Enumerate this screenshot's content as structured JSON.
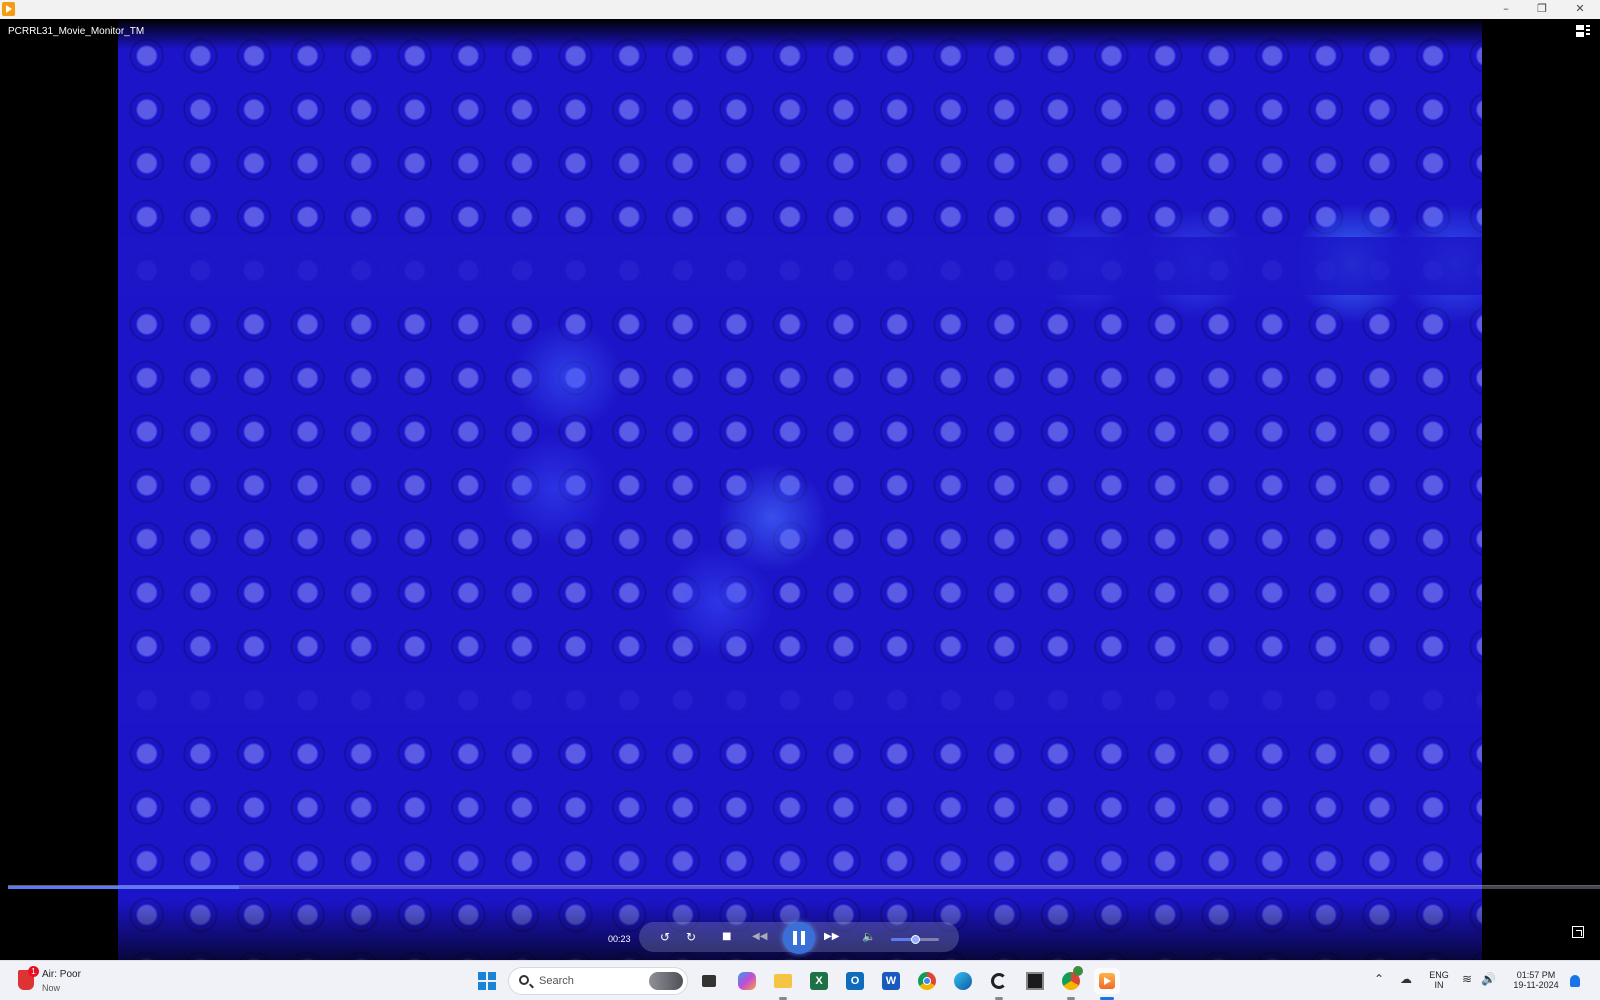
{
  "window": {
    "title": "",
    "minimize_icon": "minimize-icon",
    "maximize_icon": "restore-icon",
    "close_icon": "close-icon"
  },
  "player": {
    "media_title": "PCRRL31_Movie_Monitor_TM",
    "current_time": "00:23",
    "progress": 0.145,
    "volume": 0.5,
    "accent_color": "#3b6fd8",
    "video_dominant_color": "#1c14c8",
    "controls": {
      "rewind_icon": "skip-back-10-icon",
      "forward_icon": "skip-forward-30-icon",
      "stop_icon": "stop-icon",
      "previous_icon": "previous-track-icon",
      "play_pause_icon": "pause-icon",
      "next_icon": "next-track-icon",
      "volume_icon": "volume-icon",
      "fullscreen_icon": "fullscreen-icon",
      "layout_icon": "playlist-layout-icon"
    }
  },
  "taskbar": {
    "weather": {
      "title": "Air: Poor",
      "subtitle": "Now",
      "badge": "1"
    },
    "search_placeholder": "Search",
    "apps": [
      "windows-start-icon",
      "file-manager-icon",
      "copilot-icon",
      "file-explorer-icon",
      "excel-icon",
      "outlook-icon",
      "word-icon",
      "chrome-icon",
      "edge-icon",
      "app-icon",
      "terminal-icon",
      "chrome-profile-icon",
      "media-player-icon"
    ],
    "tray": {
      "language_top": "ENG",
      "language_bottom": "IN",
      "time": "01:57 PM",
      "date": "19-11-2024"
    }
  }
}
